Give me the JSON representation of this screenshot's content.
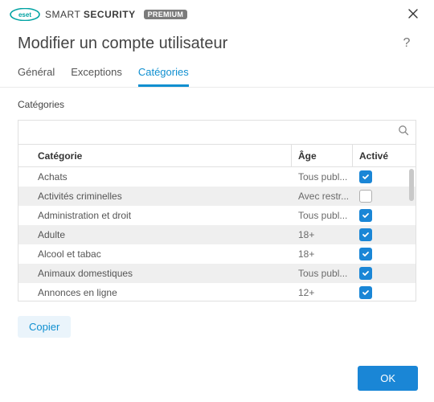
{
  "brand": {
    "name_part1": "SMART",
    "name_part2": "SECURITY",
    "badge": "PREMIUM"
  },
  "page_title": "Modifier un compte utilisateur",
  "tabs": {
    "general": "Général",
    "exceptions": "Exceptions",
    "categories": "Catégories"
  },
  "section_label": "Catégories",
  "table": {
    "headers": {
      "category": "Catégorie",
      "age": "Âge",
      "enabled": "Activé"
    },
    "rows": [
      {
        "category": "Achats",
        "age": "Tous publ...",
        "enabled": true
      },
      {
        "category": "Activités criminelles",
        "age": "Avec restr...",
        "enabled": false
      },
      {
        "category": "Administration et droit",
        "age": "Tous publ...",
        "enabled": true
      },
      {
        "category": "Adulte",
        "age": "18+",
        "enabled": true
      },
      {
        "category": "Alcool et tabac",
        "age": "18+",
        "enabled": true
      },
      {
        "category": "Animaux domestiques",
        "age": "Tous publ...",
        "enabled": true
      },
      {
        "category": "Annonces en ligne",
        "age": "12+",
        "enabled": true
      }
    ]
  },
  "buttons": {
    "copy": "Copier",
    "ok": "OK"
  }
}
